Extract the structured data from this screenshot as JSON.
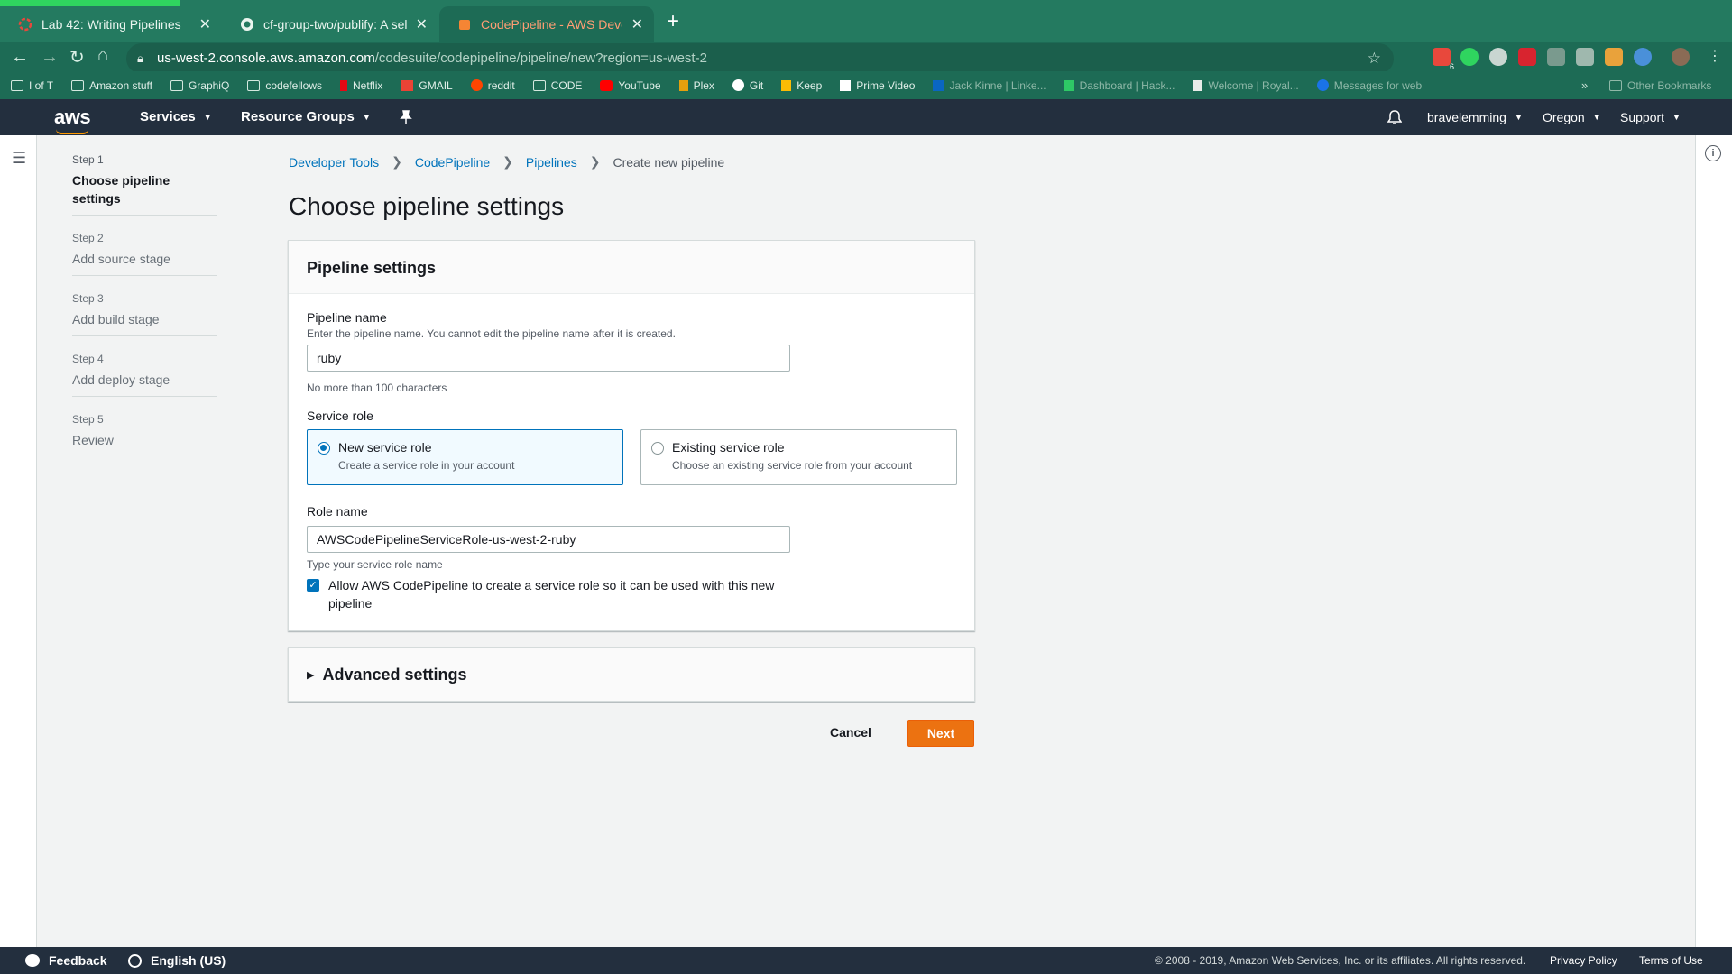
{
  "browser": {
    "tabs": [
      {
        "title": "Lab 42: Writing Pipelines",
        "active": false
      },
      {
        "title": "cf-group-two/publify: A self hos",
        "active": false
      },
      {
        "title": "CodePipeline - AWS Developer",
        "active": true
      }
    ],
    "new_tab_label": "+",
    "url_host": "us-west-2.console.aws.amazon.com",
    "url_path": "/codesuite/codepipeline/pipeline/new?region=us-west-2",
    "extension_badge": "6",
    "bookmarks": [
      {
        "label": "I of T",
        "icon": "folder-icon"
      },
      {
        "label": "Amazon stuff",
        "icon": "folder-icon"
      },
      {
        "label": "GraphiQ",
        "icon": "folder-icon"
      },
      {
        "label": "codefellows",
        "icon": "folder-icon"
      },
      {
        "label": "Netflix",
        "icon": "netflix-icon"
      },
      {
        "label": "GMAIL",
        "icon": "gmail-icon"
      },
      {
        "label": "reddit",
        "icon": "reddit-icon"
      },
      {
        "label": "CODE",
        "icon": "folder-icon"
      },
      {
        "label": "YouTube",
        "icon": "youtube-icon"
      },
      {
        "label": "Plex",
        "icon": "plex-icon"
      },
      {
        "label": "Git",
        "icon": "github-icon"
      },
      {
        "label": "Keep",
        "icon": "keep-icon"
      },
      {
        "label": "Prime Video",
        "icon": "amazon-icon"
      },
      {
        "label": "Jack Kinne | Linke...",
        "icon": "linkedin-icon"
      },
      {
        "label": "Dashboard | Hack...",
        "icon": "hackerrank-icon"
      },
      {
        "label": "Welcome | Royal...",
        "icon": "page-icon"
      },
      {
        "label": "Messages for web",
        "icon": "messages-icon"
      }
    ],
    "bookmarks_overflow": "»",
    "other_bookmarks": "Other Bookmarks"
  },
  "aws_nav": {
    "logo": "aws",
    "services": "Services",
    "resource_groups": "Resource Groups",
    "user": "bravelemming",
    "region": "Oregon",
    "support": "Support"
  },
  "steps": [
    {
      "num": "Step 1",
      "label": "Choose pipeline settings",
      "current": true
    },
    {
      "num": "Step 2",
      "label": "Add source stage",
      "current": false
    },
    {
      "num": "Step 3",
      "label": "Add build stage",
      "current": false
    },
    {
      "num": "Step 4",
      "label": "Add deploy stage",
      "current": false
    },
    {
      "num": "Step 5",
      "label": "Review",
      "current": false
    }
  ],
  "breadcrumb": {
    "items": [
      "Developer Tools",
      "CodePipeline",
      "Pipelines"
    ],
    "current": "Create new pipeline"
  },
  "page_title": "Choose pipeline settings",
  "panel": {
    "title": "Pipeline settings",
    "pipeline_name": {
      "label": "Pipeline name",
      "description": "Enter the pipeline name. You cannot edit the pipeline name after it is created.",
      "value": "ruby",
      "constraint": "No more than 100 characters"
    },
    "service_role": {
      "label": "Service role",
      "options": [
        {
          "title": "New service role",
          "description": "Create a service role in your account",
          "selected": true
        },
        {
          "title": "Existing service role",
          "description": "Choose an existing service role from your account",
          "selected": false
        }
      ]
    },
    "role_name": {
      "label": "Role name",
      "value": "AWSCodePipelineServiceRole-us-west-2-ruby",
      "hint": "Type your service role name"
    },
    "allow_checkbox": {
      "checked": true,
      "label": "Allow AWS CodePipeline to create a service role so it can be used with this new pipeline"
    }
  },
  "advanced": {
    "title": "Advanced settings"
  },
  "actions": {
    "cancel": "Cancel",
    "next": "Next"
  },
  "footer": {
    "feedback": "Feedback",
    "language": "English (US)",
    "copyright": "© 2008 - 2019, Amazon Web Services, Inc. or its affiliates. All rights reserved.",
    "privacy": "Privacy Policy",
    "terms": "Terms of Use"
  },
  "colors": {
    "chrome_green": "#1d6b55",
    "aws_nav": "#232f3e",
    "link_blue": "#0073bb",
    "primary_orange": "#ec7211"
  }
}
